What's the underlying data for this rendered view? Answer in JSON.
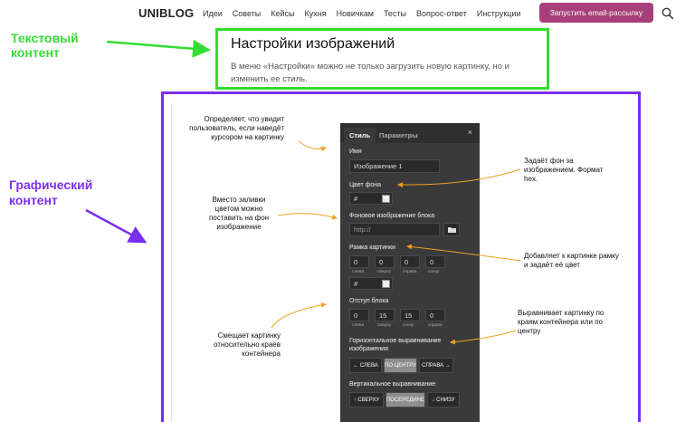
{
  "nav": {
    "logo": "UNIBLOG",
    "links": [
      "Идеи",
      "Советы",
      "Кейсы",
      "Кухня",
      "Новичкам",
      "Тесты",
      "Вопрос-ответ",
      "Инструкции"
    ],
    "cta": "Запустить email-рассылку",
    "search_icon": "search-icon"
  },
  "annotations": {
    "text_content": "Текстовый\nконтент",
    "graphic_content": "Графический\nконтент",
    "green": "#33dd33",
    "purple": "#7a2fee"
  },
  "article": {
    "title": "Настройки изображений",
    "lead": "В меню «Настройки» можно не только загрузить новую картинку, но и изменить ее стиль."
  },
  "panel": {
    "tabs": [
      "Стиль",
      "Параметры"
    ],
    "name_label": "Имя",
    "name_value": "Изображение 1",
    "bg_color_label": "Цвет фона",
    "bg_color_value": "#",
    "bg_image_label": "Фоновое изображение блока",
    "bg_image_placeholder": "http://",
    "frame_label": "Рамка картинки",
    "frame_values": [
      "0",
      "0",
      "0",
      "0"
    ],
    "frame_sides": [
      "слева",
      "сверху",
      "справа",
      "снизу"
    ],
    "frame_color": "#",
    "padding_label": "Отступ блока",
    "padding_values": [
      "0",
      "15",
      "15",
      "0"
    ],
    "padding_sides": [
      "слева",
      "сверху",
      "снизу",
      "справа"
    ],
    "halign_label": "Горизонтальное выравнивание изображения",
    "halign_options": [
      "← СЛЕВА",
      "ПО ЦЕНТРУ",
      "СПРАВА →"
    ],
    "valign_label": "Вертикальное выравнивание",
    "valign_options": [
      "↑ СВЕРХУ",
      "ПОСЕРЕДИНЕ",
      "↓ СНИЗУ"
    ]
  },
  "callouts": {
    "name": "Определяет, что увидит пользователь, если наведёт курсором на картинку",
    "bg_color": "Задаёт фон за изображением. Формат hex.",
    "bg_image": "Вместо заливки цветом можно поставить на фон изображение",
    "frame": "Добавляет к картинке рамку и задаёт её цвет",
    "padding": "Смещает картинку относительно краёв контейнера",
    "align": "Выравнивает картинку по краям контейнера или по центру"
  }
}
